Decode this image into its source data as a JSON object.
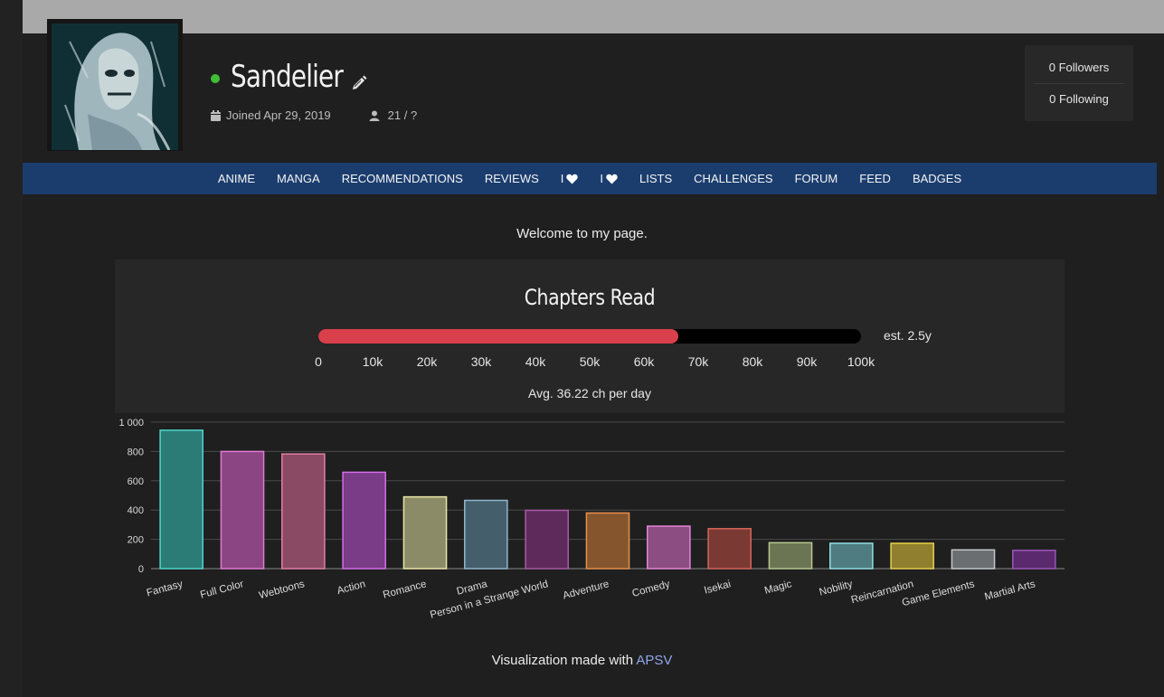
{
  "profile": {
    "username": "Sandelier",
    "joined": "Joined Apr 29, 2019",
    "stat": "21 / ?",
    "status_color": "#3fbe36"
  },
  "follow": {
    "followers": "0 Followers",
    "following": "0 Following"
  },
  "nav": {
    "items": [
      "ANIME",
      "MANGA",
      "RECOMMENDATIONS",
      "REVIEWS",
      "I",
      "I",
      "LISTS",
      "CHALLENGES",
      "FORUM",
      "FEED",
      "BADGES"
    ],
    "heart_icons": [
      "heart-icon",
      "heart-icon"
    ]
  },
  "welcome": "Welcome to my page.",
  "chapters": {
    "title": "Chapters Read",
    "progress_fraction": 0.663,
    "est": "est. 2.5y",
    "ticks": [
      "0",
      "10k",
      "20k",
      "30k",
      "40k",
      "50k",
      "60k",
      "70k",
      "80k",
      "90k",
      "100k"
    ],
    "avg": "Avg. 36.22 ch per day",
    "fill_color": "#d9404b"
  },
  "chart_data": {
    "type": "bar",
    "categories": [
      "Fantasy",
      "Full Color",
      "Webtoons",
      "Action",
      "Romance",
      "Drama",
      "Person in a Strange World",
      "Adventure",
      "Comedy",
      "Isekai",
      "Magic",
      "Nobility",
      "Reincarnation",
      "Game Elements",
      "Martial Arts"
    ],
    "values": [
      945,
      800,
      783,
      658,
      490,
      466,
      398,
      380,
      290,
      273,
      177,
      173,
      173,
      128,
      125
    ],
    "ylim": [
      0,
      1000
    ],
    "yticks": [
      "0",
      "200",
      "400",
      "600",
      "800",
      "1 000"
    ],
    "grid": true,
    "colors": [
      {
        "fill": "#2b7b76",
        "stroke": "#4fd6cc"
      },
      {
        "fill": "#8b4582",
        "stroke": "#e27ad6"
      },
      {
        "fill": "#8a4a64",
        "stroke": "#e27ea6"
      },
      {
        "fill": "#7a3b87",
        "stroke": "#d46ee8"
      },
      {
        "fill": "#8b8b68",
        "stroke": "#e9e6a6"
      },
      {
        "fill": "#455e6c",
        "stroke": "#8fb6cc"
      },
      {
        "fill": "#5e2a5c",
        "stroke": "#a85aa6"
      },
      {
        "fill": "#85552e",
        "stroke": "#e6914c"
      },
      {
        "fill": "#8b4d82",
        "stroke": "#e686d6"
      },
      {
        "fill": "#7a3a33",
        "stroke": "#d4655a"
      },
      {
        "fill": "#6b7553",
        "stroke": "#b9c98f"
      },
      {
        "fill": "#4e7c80",
        "stroke": "#8fe0e6"
      },
      {
        "fill": "#8f7f2e",
        "stroke": "#e6cf4c"
      },
      {
        "fill": "#6b6e70",
        "stroke": "#c4c8cc"
      },
      {
        "fill": "#5b2a6e",
        "stroke": "#9a56b6"
      }
    ]
  },
  "footer": {
    "text": "Visualization made with",
    "link": "APSV"
  }
}
